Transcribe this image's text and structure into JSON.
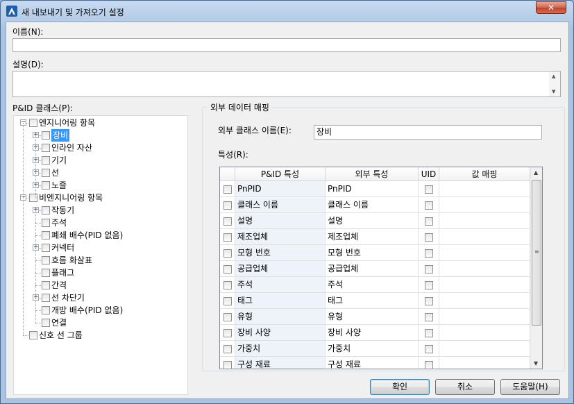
{
  "window": {
    "title": "새 내보내기 및 가져오기 설정",
    "close_glyph": "✕"
  },
  "name": {
    "label": "이름(N):",
    "value": ""
  },
  "description": {
    "label": "설명(D):",
    "value": ""
  },
  "tree": {
    "label": "P&ID 클래스(P):",
    "items": [
      {
        "label": "엔지니어링 항목",
        "level": 0,
        "expander": "−"
      },
      {
        "label": "장비",
        "level": 1,
        "expander": "+",
        "selected": true
      },
      {
        "label": "인라인 자산",
        "level": 1,
        "expander": "+"
      },
      {
        "label": "기기",
        "level": 1,
        "expander": "+"
      },
      {
        "label": "선",
        "level": 1,
        "expander": "+"
      },
      {
        "label": "노즐",
        "level": 1,
        "expander": "+"
      },
      {
        "label": "비엔지니어링 항목",
        "level": 0,
        "expander": "−"
      },
      {
        "label": "작동기",
        "level": 1,
        "expander": "+"
      },
      {
        "label": "주석",
        "level": 1,
        "expander": ""
      },
      {
        "label": "폐쇄 배수(PID 없음)",
        "level": 1,
        "expander": ""
      },
      {
        "label": "커넥터",
        "level": 1,
        "expander": "+"
      },
      {
        "label": "흐름 화살표",
        "level": 1,
        "expander": ""
      },
      {
        "label": "플래그",
        "level": 1,
        "expander": ""
      },
      {
        "label": "간격",
        "level": 1,
        "expander": ""
      },
      {
        "label": "선 차단기",
        "level": 1,
        "expander": "+"
      },
      {
        "label": "개방 배수(PID 없음)",
        "level": 1,
        "expander": ""
      },
      {
        "label": "연결",
        "level": 1,
        "expander": ""
      },
      {
        "label": "신호 선 그룹",
        "level": 0,
        "expander": ""
      }
    ]
  },
  "mapping": {
    "group_label": "외부 데이터 매핑",
    "external_class_label": "외부 클래스 이름(E):",
    "external_class_value": "장비",
    "properties_label": "특성(R):",
    "columns": [
      "P&ID 특성",
      "외부 특성",
      "UID",
      "값 매핑"
    ],
    "rows": [
      {
        "pid": "PnPID",
        "ext": "PnPID"
      },
      {
        "pid": "클래스 이름",
        "ext": "클래스 이름"
      },
      {
        "pid": "설명",
        "ext": "설명"
      },
      {
        "pid": "제조업체",
        "ext": "제조업체"
      },
      {
        "pid": "모형 번호",
        "ext": "모형 번호"
      },
      {
        "pid": "공급업체",
        "ext": "공급업체"
      },
      {
        "pid": "주석",
        "ext": "주석"
      },
      {
        "pid": "태그",
        "ext": "태그"
      },
      {
        "pid": "유형",
        "ext": "유형"
      },
      {
        "pid": "장비 사양",
        "ext": "장비 사양"
      },
      {
        "pid": "가중치",
        "ext": "가중치"
      },
      {
        "pid": "구성 재료",
        "ext": "구성 재료"
      }
    ]
  },
  "buttons": {
    "ok": "확인",
    "cancel": "취소",
    "help": "도움말(H)"
  }
}
